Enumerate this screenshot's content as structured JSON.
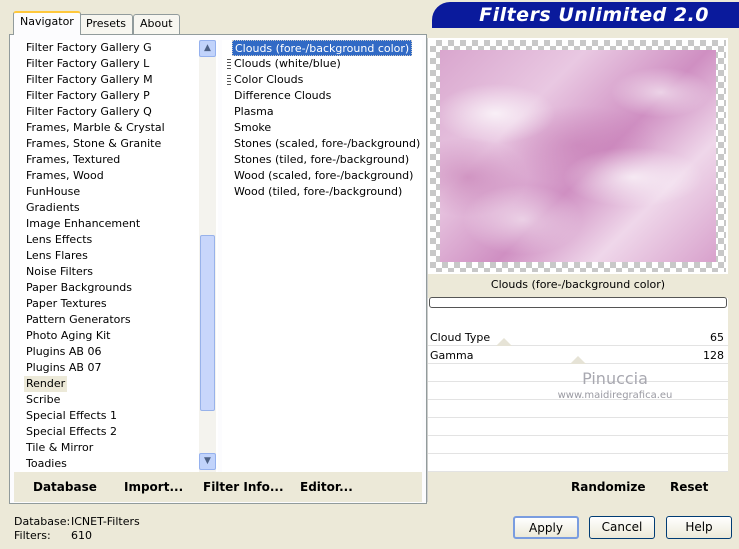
{
  "title": "Filters Unlimited 2.0",
  "tabs": [
    {
      "label": "Navigator",
      "active": true
    },
    {
      "label": "Presets",
      "active": false
    },
    {
      "label": "About",
      "active": false
    }
  ],
  "categories": [
    "Filter Factory Gallery G",
    "Filter Factory Gallery L",
    "Filter Factory Gallery M",
    "Filter Factory Gallery P",
    "Filter Factory Gallery Q",
    "Frames, Marble & Crystal",
    "Frames, Stone & Granite",
    "Frames, Textured",
    "Frames, Wood",
    "FunHouse",
    "Gradients",
    "Image Enhancement",
    "Lens Effects",
    "Lens Flares",
    "Noise Filters",
    "Paper Backgrounds",
    "Paper Textures",
    "Pattern Generators",
    "Photo Aging Kit",
    "Plugins AB 06",
    "Plugins AB 07",
    "Render",
    "Scribe",
    "Special Effects 1",
    "Special Effects 2",
    "Tile & Mirror",
    "Toadies"
  ],
  "selected_category": "Render",
  "filters": [
    "Clouds (fore-/background color)",
    "Clouds (white/blue)",
    "Color Clouds",
    "Difference Clouds",
    "Plasma",
    "Smoke",
    "Stones (scaled, fore-/background)",
    "Stones (tiled, fore-/background)",
    "Wood (scaled, fore-/background)",
    "Wood (tiled, fore-/background)"
  ],
  "selected_filter": "Clouds (fore-/background color)",
  "preview_caption": "Clouds (fore-/background color)",
  "parameters": [
    {
      "label": "Cloud Type",
      "value": "65"
    },
    {
      "label": "Gamma",
      "value": "128"
    }
  ],
  "watermark": {
    "line1": "Pinuccia",
    "line2": "www.maidiregrafica.eu"
  },
  "left_toolbar": {
    "database": "Database",
    "import": "Import...",
    "filter_info": "Filter Info...",
    "editor": "Editor..."
  },
  "right_toolbar": {
    "randomize": "Randomize",
    "reset": "Reset"
  },
  "status": {
    "database_label": "Database:",
    "database_value": "ICNET-Filters",
    "filters_label": "Filters:",
    "filters_value": "610"
  },
  "buttons": {
    "apply": "Apply",
    "cancel": "Cancel",
    "help": "Help"
  },
  "colors": {
    "banner": "#0a1a9c",
    "selection": "#316ac5"
  },
  "icons": {
    "scroll_up": "chevron-up-icon",
    "scroll_down": "chevron-down-icon"
  }
}
